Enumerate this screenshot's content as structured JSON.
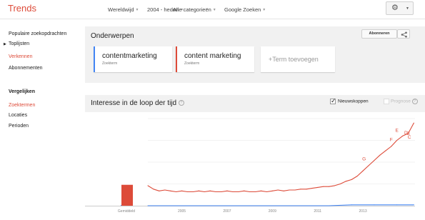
{
  "app": {
    "logo": "Trends"
  },
  "filters": [
    {
      "label": "Wereldwijd"
    },
    {
      "label": "2004 - heden"
    },
    {
      "label": "Alle categorieën"
    },
    {
      "label": "Google Zoeken"
    }
  ],
  "sidebar": {
    "items": [
      {
        "label": "Populaire zoekopdrachten"
      },
      {
        "label": "Toplijsten"
      },
      {
        "label": "Verkennen"
      },
      {
        "label": "Abonnementen"
      }
    ],
    "compare_heading": "Vergelijken",
    "compare_items": [
      {
        "label": "Zoektermen"
      },
      {
        "label": "Locaties"
      },
      {
        "label": "Perioden"
      }
    ]
  },
  "topics": {
    "title": "Onderwerpen",
    "subscribe_label": "Abonneren",
    "terms": [
      {
        "term": "contentmarketing",
        "type": "Zoekterm",
        "color": "#4285f4"
      },
      {
        "term": "content marketing",
        "type": "Zoekterm",
        "color": "#dd4b39"
      }
    ],
    "add_term_label": "+Term toevoegen"
  },
  "interest": {
    "title": "Interesse in de loop der tijd",
    "news_label": "Nieuwskoppen",
    "forecast_label": "Prognose"
  },
  "chart_data": {
    "type": "line",
    "average_label": "Gemiddeld",
    "average_bars": [
      {
        "series": "contentmarketing",
        "value": 0,
        "color": "#4285f4"
      },
      {
        "series": "content marketing",
        "value": 24,
        "color": "#dd4b39"
      }
    ],
    "x_tick_labels": [
      "2005",
      "2007",
      "2009",
      "2011",
      "2013"
    ],
    "x_ticks": [
      2005.5,
      2007.5,
      2009.5,
      2011.5,
      2013.5
    ],
    "xlim": [
      2004.0,
      2015.8
    ],
    "ylim": [
      0,
      100
    ],
    "grid": true,
    "annotations": [
      {
        "letter": "G",
        "x": 2013.55,
        "y": 52
      },
      {
        "letter": "F",
        "x": 2014.75,
        "y": 74
      },
      {
        "letter": "E",
        "x": 2015.0,
        "y": 85
      },
      {
        "letter": "D",
        "x": 2015.4,
        "y": 82
      },
      {
        "letter": "C",
        "x": 2015.55,
        "y": 77
      },
      {
        "letter": "B",
        "x": 2015.5,
        "y": 81
      }
    ],
    "series": [
      {
        "name": "content marketing",
        "color": "#dd4b39",
        "x": [
          2004.0,
          2004.25,
          2004.5,
          2004.75,
          2005.0,
          2005.25,
          2005.5,
          2005.75,
          2006.0,
          2006.25,
          2006.5,
          2006.75,
          2007.0,
          2007.25,
          2007.5,
          2007.75,
          2008.0,
          2008.25,
          2008.5,
          2008.75,
          2009.0,
          2009.25,
          2009.5,
          2009.75,
          2010.0,
          2010.25,
          2010.5,
          2010.75,
          2011.0,
          2011.25,
          2011.5,
          2011.75,
          2012.0,
          2012.25,
          2012.5,
          2012.75,
          2013.0,
          2013.25,
          2013.5,
          2013.75,
          2014.0,
          2014.25,
          2014.5,
          2014.75,
          2015.0,
          2015.25,
          2015.5,
          2015.75
        ],
        "values": [
          23,
          19,
          17,
          18,
          17,
          16,
          17,
          16,
          16,
          17,
          16,
          17,
          16,
          16,
          17,
          16,
          16,
          17,
          16,
          16,
          17,
          16,
          17,
          18,
          17,
          18,
          18,
          19,
          19,
          20,
          21,
          22,
          22,
          23,
          25,
          28,
          30,
          34,
          40,
          46,
          52,
          58,
          63,
          68,
          75,
          80,
          83,
          95
        ]
      },
      {
        "name": "contentmarketing",
        "color": "#4285f4",
        "x": [
          2004.0,
          2006.0,
          2008.0,
          2010.0,
          2012.0,
          2013.0,
          2014.0,
          2015.0,
          2015.75
        ],
        "values": [
          0,
          0,
          0,
          0,
          0,
          1,
          1,
          1,
          1
        ]
      }
    ]
  }
}
